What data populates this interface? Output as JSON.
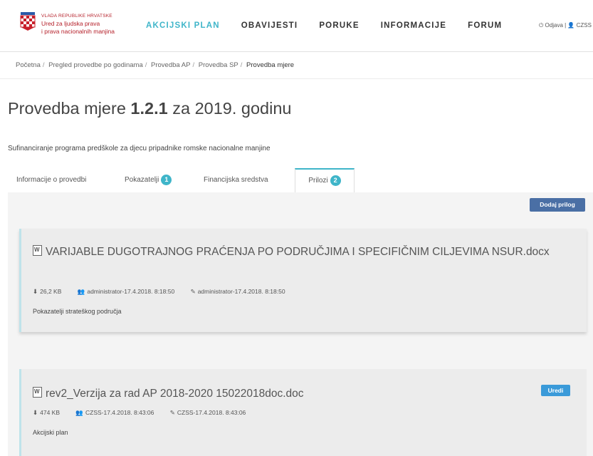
{
  "header": {
    "logo_line1": "VLADA REPUBLIKE HRVATSKE",
    "logo_line2": "Ured za ljudska prava",
    "logo_line3": "i prava nacionalnih manjina",
    "nav": [
      "AKCIJSKI PLAN",
      "OBAVIJESTI",
      "PORUKE",
      "INFORMACIJE",
      "FORUM"
    ],
    "active_nav": "AKCIJSKI PLAN",
    "user_text": "⏻ Odjava | 👤 CZSS",
    "accent_color": "#3fb5c9"
  },
  "breadcrumb": [
    "Početna",
    "Pregled provedbe po godinama",
    "Provedba AP",
    "Provedba SP",
    "Provedba mjere"
  ],
  "title": {
    "prefix": "Provedba mjere ",
    "measure": "1.2.1",
    "suffix": " za 2019. godinu"
  },
  "subtitle": "Sufinanciranje programa predškole za djecu pripadnike romske nacionalne manjine",
  "tabs": [
    {
      "label": "Informacije o provedbi",
      "badge": ""
    },
    {
      "label": "Pokazatelji",
      "badge": "1"
    },
    {
      "label": "Financijska sredstva",
      "badge": ""
    },
    {
      "label": "Prilozi",
      "badge": "2"
    }
  ],
  "active_tab": "Prilozi",
  "add_button": "Dodaj prilog",
  "attachments": [
    {
      "title": "VARIJABLE DUGOTRAJNOG PRAĆENJA PO PODRUČJIMA I SPECIFIČNIM CILJEVIMA NSUR.docx",
      "size": "26,2 KB",
      "created": "administrator-17.4.2018. 8:18:50",
      "modified": "administrator-17.4.2018. 8:18:50",
      "description": "Pokazatelji strateškog područja",
      "edit_label": ""
    },
    {
      "title": "rev2_Verzija za rad AP 2018-2020 15022018doc.doc",
      "size": "474 KB",
      "created": "CZSS-17.4.2018. 8:43:06",
      "modified": "CZSS-17.4.2018. 8:43:06",
      "description": "Akcijski plan",
      "edit_label": "Uredi"
    }
  ]
}
